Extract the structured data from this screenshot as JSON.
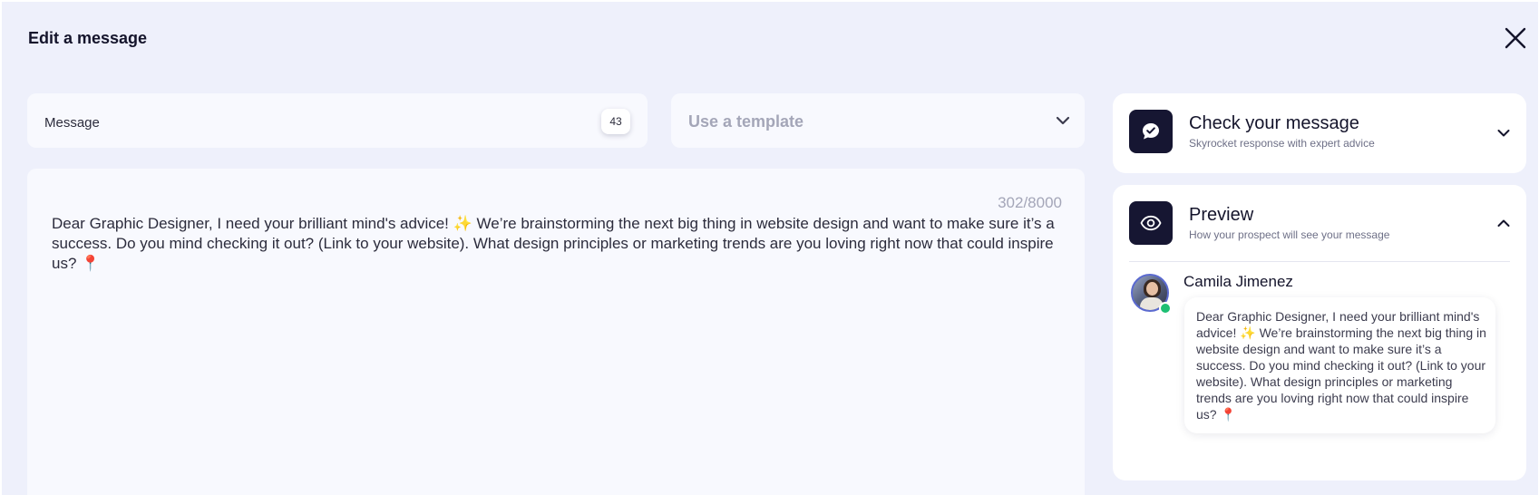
{
  "modal": {
    "title": "Edit a message"
  },
  "form": {
    "message_field_label": "Message",
    "message_count_badge": "43",
    "template_placeholder": "Use a template",
    "char_count": "302/8000",
    "message_text": "Dear Graphic Designer, I need your brilliant mind's advice! ✨ We’re brainstorming the next big thing in website design and want to make sure it’s a success. Do you mind checking it out? (Link to your website). What design principles or marketing trends are you loving right now that could inspire us? 📍"
  },
  "check_card": {
    "title": "Check your message",
    "subtitle": "Skyrocket response with expert advice"
  },
  "preview_card": {
    "title": "Preview",
    "subtitle": "How your prospect will see your message",
    "sender_name": "Camila Jimenez",
    "bubble_text": "Dear Graphic Designer, I need your brilliant mind's advice! ✨ We’re brainstorming the next big thing in website design and want to make sure it’s a success. Do you mind checking it out? (Link to your website). What design principles or marketing trends are you loving right now that could inspire us? 📍"
  },
  "icons": {
    "close": "close-icon",
    "template_dropdown": "chevron-down-icon",
    "check_message": "chat-check-icon",
    "check_toggle": "chevron-down-icon",
    "preview": "eye-icon",
    "preview_toggle": "chevron-up-icon",
    "online_status": "online-status-icon"
  },
  "colors": {
    "background": "#eef0fb",
    "icon_tile": "#161632",
    "online": "#1dbf73",
    "muted_text": "#a4a6b8"
  }
}
